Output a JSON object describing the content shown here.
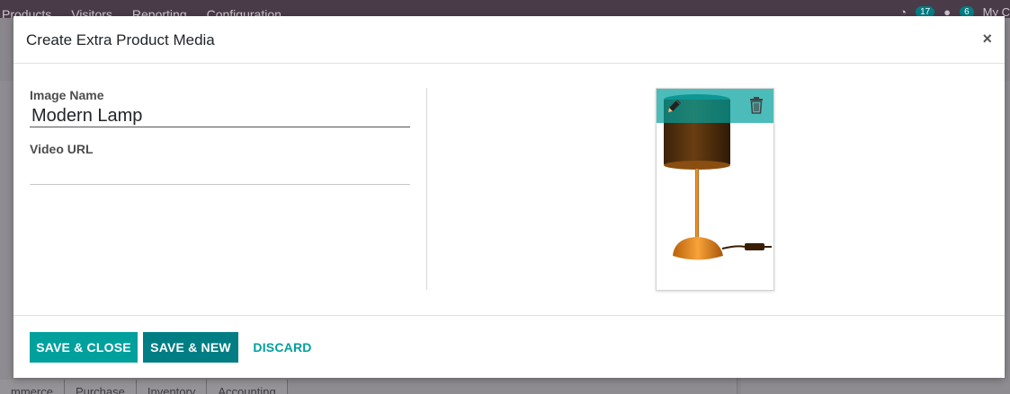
{
  "background": {
    "menu": [
      "Products",
      "Visitors",
      "Reporting",
      "Configuration"
    ],
    "activity_count": "17",
    "message_count": "6",
    "user_label": "My C",
    "tabs": [
      "mmerce",
      "Purchase",
      "Inventory",
      "Accounting"
    ]
  },
  "modal": {
    "title": "Create Extra Product Media",
    "close_glyph": "×",
    "form": {
      "image_name_label": "Image Name",
      "image_name_value": "Modern Lamp",
      "video_url_label": "Video URL",
      "video_url_value": ""
    },
    "image": {
      "edit_icon": "pencil-icon",
      "delete_icon": "trash-icon"
    },
    "footer": {
      "save_close_label": "SAVE & CLOSE",
      "save_new_label": "SAVE & NEW",
      "discard_label": "DISCARD"
    }
  },
  "colors": {
    "primary": "#00a09d",
    "primary_dark": "#017e84",
    "topbar": "#4a3b49"
  }
}
